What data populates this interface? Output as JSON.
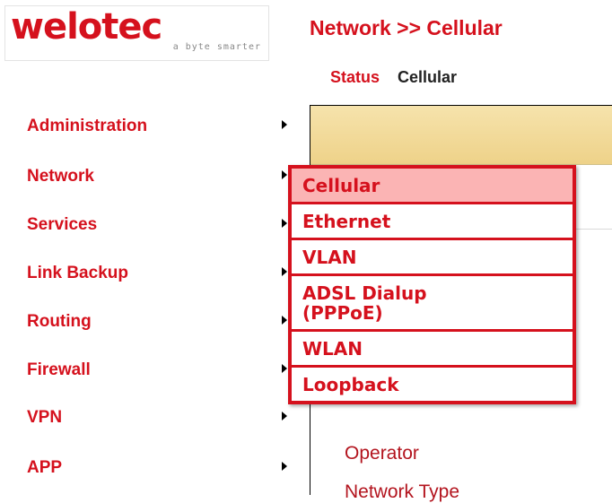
{
  "logo": {
    "brand": "welotec",
    "tagline": "a byte smarter"
  },
  "header": {
    "title": "Network >> Cellular"
  },
  "tabs": [
    {
      "label": "Status"
    },
    {
      "label": "Cellular"
    }
  ],
  "sidebar": {
    "items": [
      {
        "label": "Administration"
      },
      {
        "label": "Network"
      },
      {
        "label": "Services"
      },
      {
        "label": "Link Backup"
      },
      {
        "label": "Routing"
      },
      {
        "label": "Firewall"
      },
      {
        "label": "VPN"
      },
      {
        "label": "APP"
      }
    ]
  },
  "submenu": {
    "items": [
      {
        "label": "Cellular"
      },
      {
        "label": "Ethernet"
      },
      {
        "label": "VLAN"
      },
      {
        "label_line1": "ADSL Dialup",
        "label_line2": "(PPPoE)"
      },
      {
        "label": "WLAN"
      },
      {
        "label": "Loopback"
      }
    ]
  },
  "content": {
    "links": [
      {
        "label": "Operator"
      },
      {
        "label": "Network Type"
      }
    ]
  },
  "colors": {
    "brand": "#d5111d",
    "highlight": "#fbb4b4",
    "header_panel": "#f2d896"
  }
}
